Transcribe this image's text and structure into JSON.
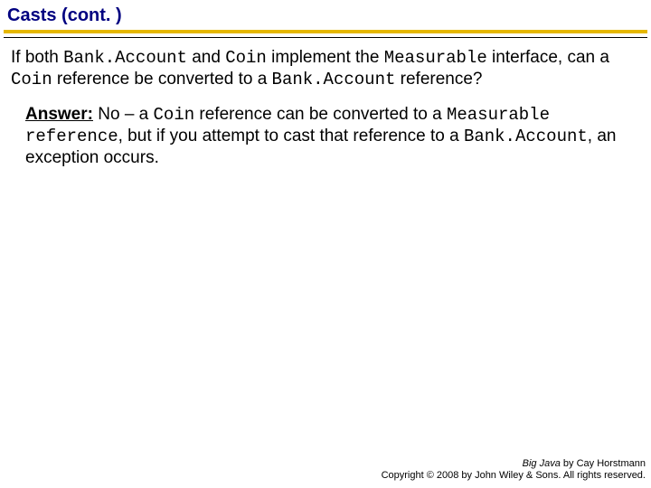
{
  "title": "Casts (cont. )",
  "question": {
    "p1": "If both ",
    "code1": "Bank.Account",
    "p2": " and ",
    "code2": "Coin",
    "p3": " implement the ",
    "code3": "Measurable",
    "p4": " interface, can a ",
    "code4": "Coin",
    "p5": " reference be converted to a ",
    "code5": "Bank.Account",
    "p6": " reference?"
  },
  "answer": {
    "label": "Answer:",
    "p1": " No – a ",
    "code1": "Coin",
    "p2": " reference can be converted to a ",
    "code2": "Measurable",
    "p3": " reference",
    "p4": ", but if you attempt to cast that reference to a ",
    "code3": "Bank.Account",
    "p5": ", an exception occurs."
  },
  "footer": {
    "book": "Big Java",
    "byline": " by Cay Horstmann",
    "copyright": "Copyright © 2008 by John Wiley & Sons. All rights reserved."
  }
}
